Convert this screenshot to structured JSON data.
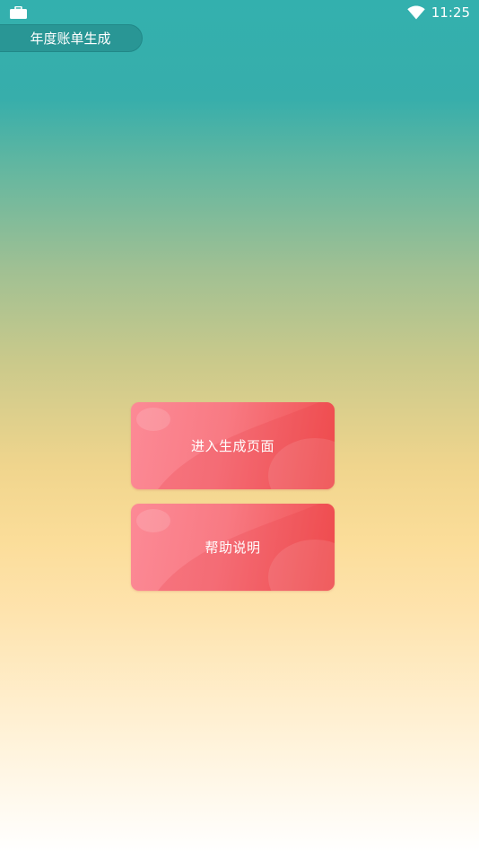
{
  "status_bar": {
    "time": "11:25",
    "left_icon": "briefcase-icon",
    "right_icon": "wifi-icon"
  },
  "header": {
    "title": "年度账单生成"
  },
  "main": {
    "buttons": [
      {
        "label": "进入生成页面"
      },
      {
        "label": "帮助说明"
      }
    ]
  },
  "colors": {
    "teal_top": "#33b0ae",
    "yellow_mid": "#f0d58d",
    "card_light": "#fc8a96",
    "card_dark": "#f04f4f"
  }
}
